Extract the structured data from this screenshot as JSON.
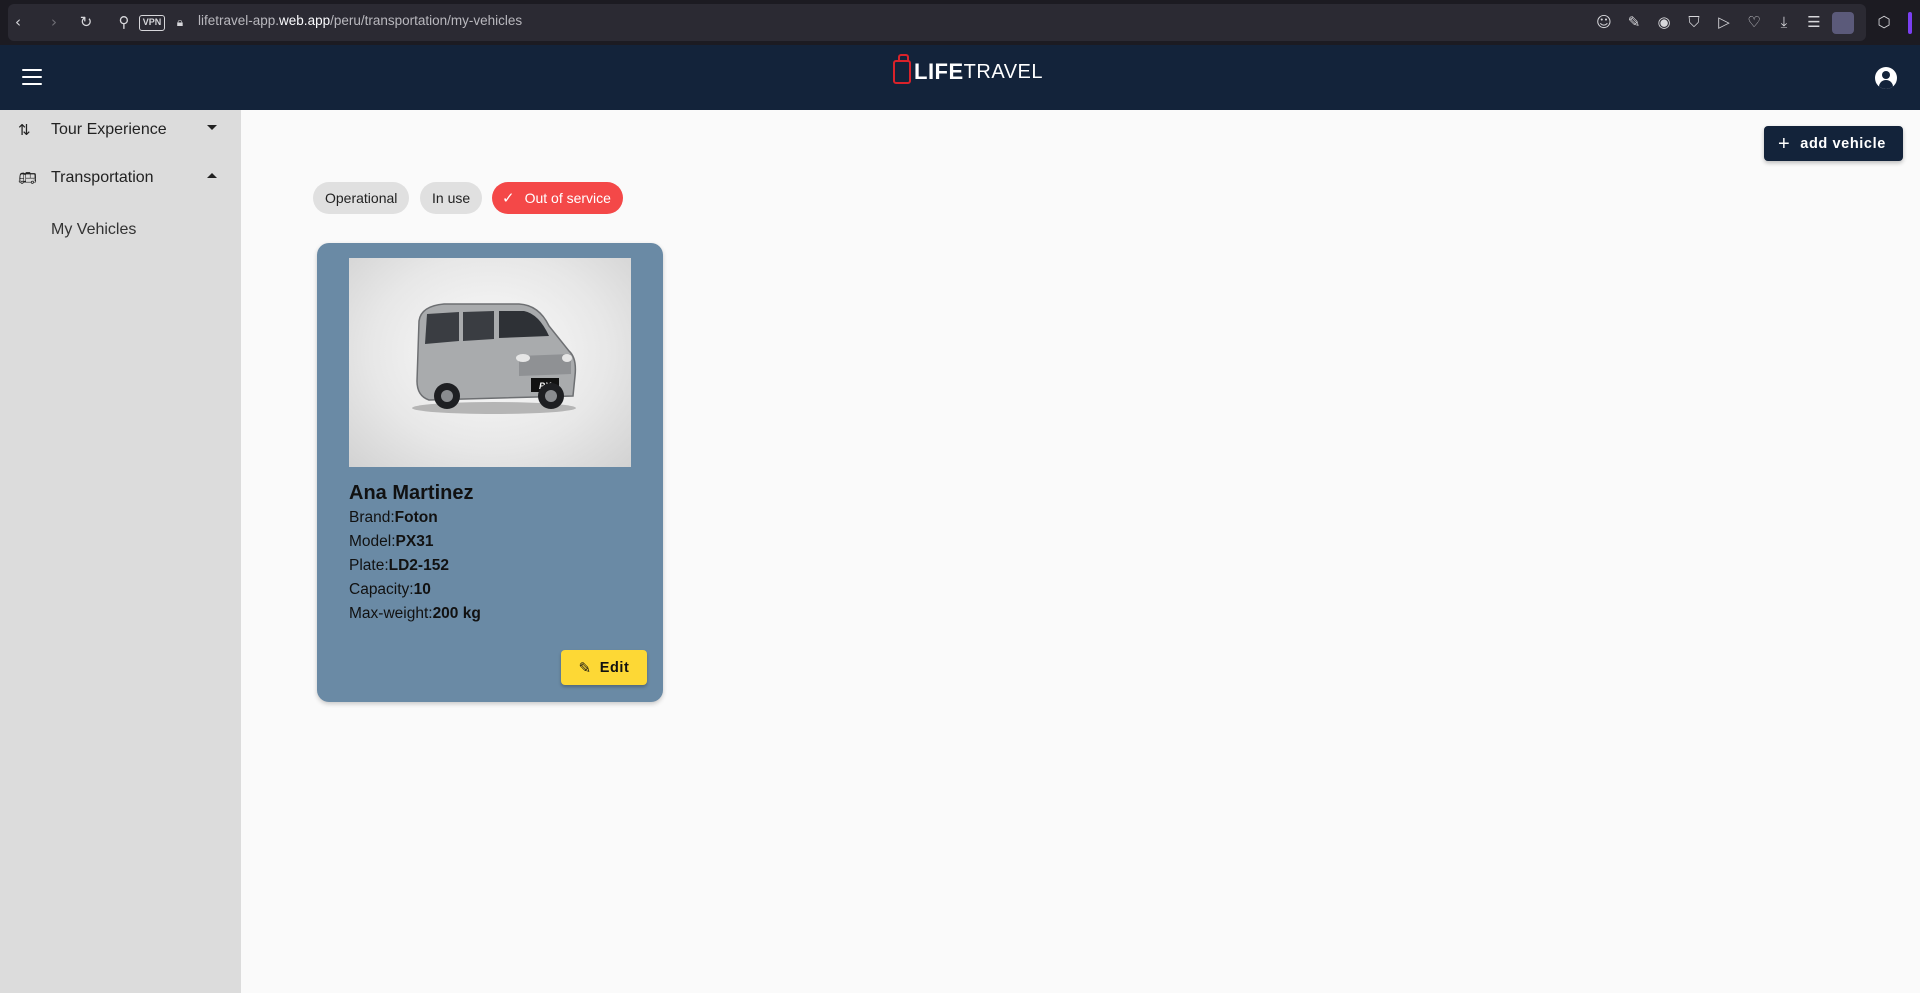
{
  "browser": {
    "url_prefix": "lifetravel-app.",
    "url_host": "web.app",
    "url_path": "/peru/transportation/my-vehicles",
    "vpn_label": "VPN"
  },
  "header": {
    "logo_bold": "LIFE",
    "logo_light": "TRAVEL"
  },
  "sidebar": {
    "items": [
      {
        "label": "Tour Experience",
        "icon": "route-icon",
        "expanded": false
      },
      {
        "label": "Transportation",
        "icon": "bus-icon",
        "expanded": true
      }
    ],
    "subitems": [
      {
        "label": "My Vehicles"
      }
    ]
  },
  "toolbar": {
    "add_label": "add vehicle"
  },
  "filters": [
    {
      "label": "Operational",
      "selected": false
    },
    {
      "label": "In use",
      "selected": false
    },
    {
      "label": "Out of service",
      "selected": true
    }
  ],
  "vehicles": [
    {
      "name": "Ana Martinez",
      "brand_label": "Brand:",
      "brand": "Foton",
      "model_label": "Model:",
      "model": "PX31",
      "plate_label": "Plate:",
      "plate": "LD2-152",
      "capacity_label": "Capacity:",
      "capacity": "10",
      "weight_label": "Max-weight:",
      "max_weight": "200 kg",
      "plate_badge": "PX",
      "edit_label": "Edit"
    }
  ],
  "colors": {
    "header_bg": "#13233a",
    "sidebar_bg": "#dcdcdc",
    "card_bg": "#6a8aa5",
    "chip_selected": "#f44848",
    "edit_btn": "#fdd835",
    "logo_accent": "#d9222a"
  }
}
